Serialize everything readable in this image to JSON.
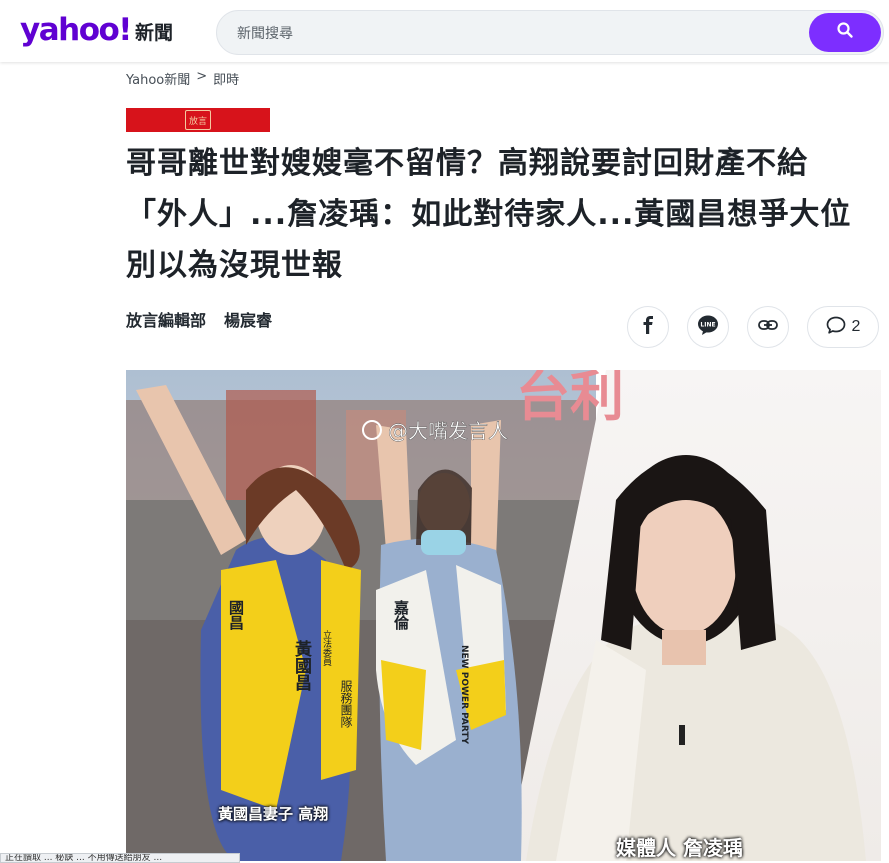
{
  "header": {
    "logo_text": "yahoo!",
    "logo_sub": "新聞",
    "search_placeholder": "新聞搜尋",
    "search_icon": "search-icon"
  },
  "breadcrumb": {
    "items": [
      "Yahoo新聞",
      "即時"
    ],
    "separator": ">"
  },
  "provider": {
    "logo_text": "放言"
  },
  "article": {
    "headline": "哥哥離世對嫂嫂毫不留情？高翔說要討回財產不給「外人」...詹凌瑀：如此對待家人...黃國昌想爭大位別以為沒現世報",
    "authors": [
      "放言編輯部",
      "楊宸睿"
    ]
  },
  "share": {
    "icons": [
      "facebook-icon",
      "line-icon",
      "link-icon",
      "comment-icon"
    ],
    "line_label": "LINE",
    "comment_count": "2"
  },
  "hero": {
    "watermark": "@大嘴发言人",
    "caption_left": "黃國昌妻子 高翔",
    "caption_right": "媒體人 詹凌瑀",
    "bg_text": "台利",
    "sash_left_1": "黃國昌",
    "sash_left_2": "立法委員",
    "sash_left_3": "服務團隊",
    "sash_left_4": "國昌",
    "sash_right_1": "嘉倫",
    "sash_right_2": "NEW POWER PARTY"
  },
  "status_bar": {
    "text": "正在讀取 ... 秘訣 ... 不用傳送給朋友 ..."
  },
  "colors": {
    "brand": "#6001d2",
    "search_button": "#7d2eff",
    "provider_red": "#d7131b"
  }
}
